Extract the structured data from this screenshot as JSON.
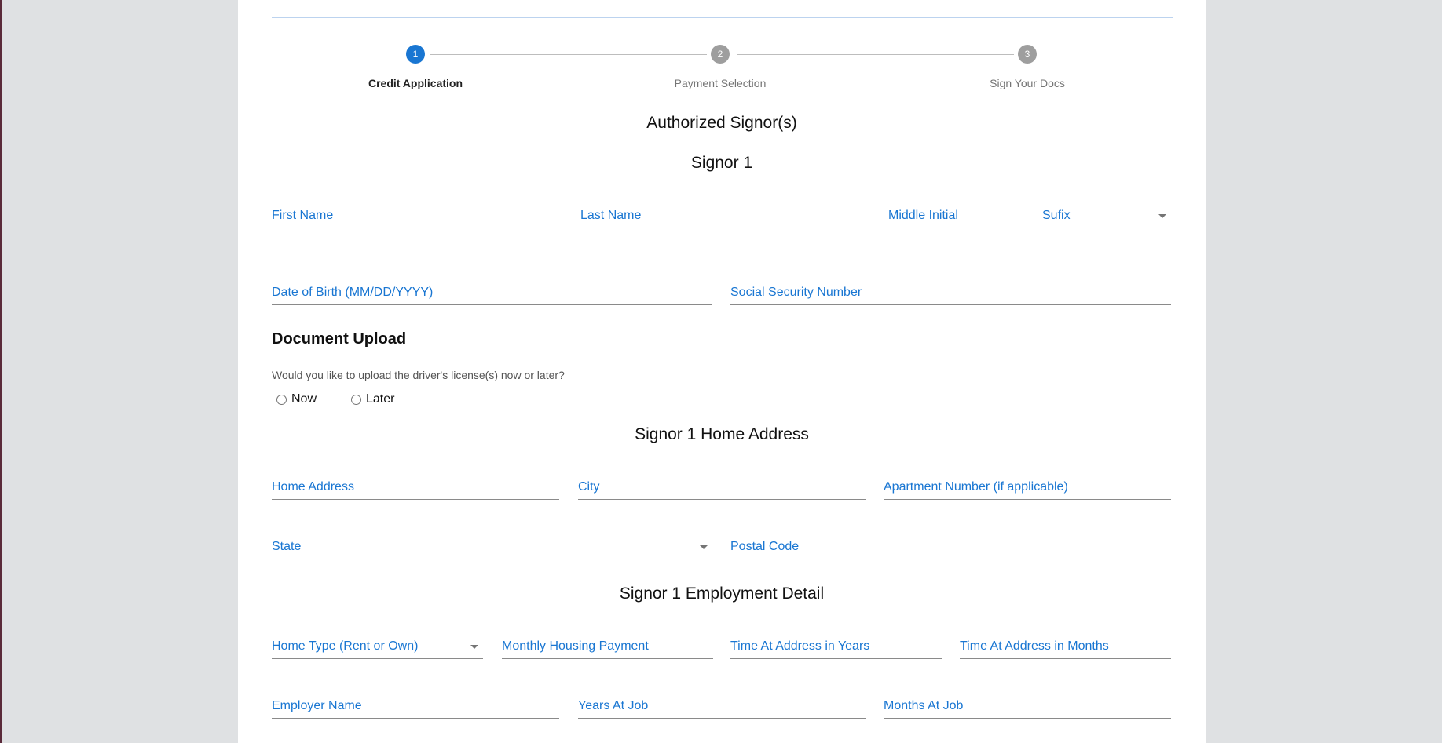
{
  "stepper": {
    "steps": [
      {
        "number": "1",
        "label": "Credit Application",
        "active": true
      },
      {
        "number": "2",
        "label": "Payment Selection",
        "active": false
      },
      {
        "number": "3",
        "label": "Sign Your Docs",
        "active": false
      }
    ]
  },
  "sections": {
    "authorized": "Authorized Signor(s)",
    "signor": "Signor 1",
    "home_address": "Signor 1 Home Address",
    "employment": "Signor 1 Employment Detail"
  },
  "fields": {
    "first_name": "First Name",
    "last_name": "Last Name",
    "middle_initial": "Middle Initial",
    "suffix": "Sufix",
    "dob": "Date of Birth (MM/DD/YYYY)",
    "ssn": "Social Security Number",
    "home_address": "Home Address",
    "city": "City",
    "apartment": "Apartment Number (if applicable)",
    "state": "State",
    "postal_code": "Postal Code",
    "home_type": "Home Type (Rent or Own)",
    "monthly_housing": "Monthly Housing Payment",
    "time_years": "Time At Address in Years",
    "time_months": "Time At Address in Months",
    "employer": "Employer Name",
    "years_job": "Years At Job",
    "months_job": "Months At Job"
  },
  "document_upload": {
    "title": "Document Upload",
    "question": "Would you like to upload the driver's license(s) now or later?",
    "options": [
      "Now",
      "Later"
    ]
  }
}
